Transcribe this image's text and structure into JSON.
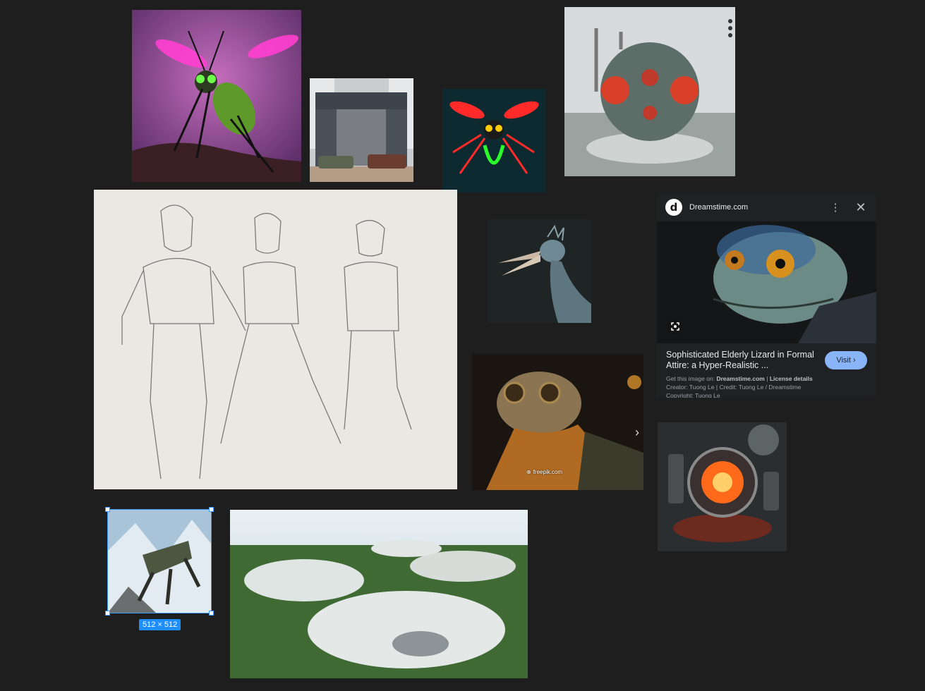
{
  "selection": {
    "size_label": "512 × 512"
  },
  "lens_panel": {
    "site_name": "Dreamstime.com",
    "logo_letter": "d",
    "more_icon": "more-vert-icon",
    "close_icon": "close-icon",
    "title": "Sophisticated Elderly Lizard in Formal Attire: a Hyper-Realistic ...",
    "visit_label": "Visit",
    "get_prefix": "Get this image on:",
    "get_site": "Dreamstime.com",
    "license": "License details",
    "creator_line": "Creator: Tuong Le | Credit: Tuong Le / Dreamstime",
    "copyright_line": "Copyright: Tuong Le"
  },
  "watermark": {
    "freepik": "freepik.com"
  },
  "colors": {
    "background": "#1e1e1e",
    "accent": "#1f8fff",
    "visit": "#8ab4f8"
  }
}
